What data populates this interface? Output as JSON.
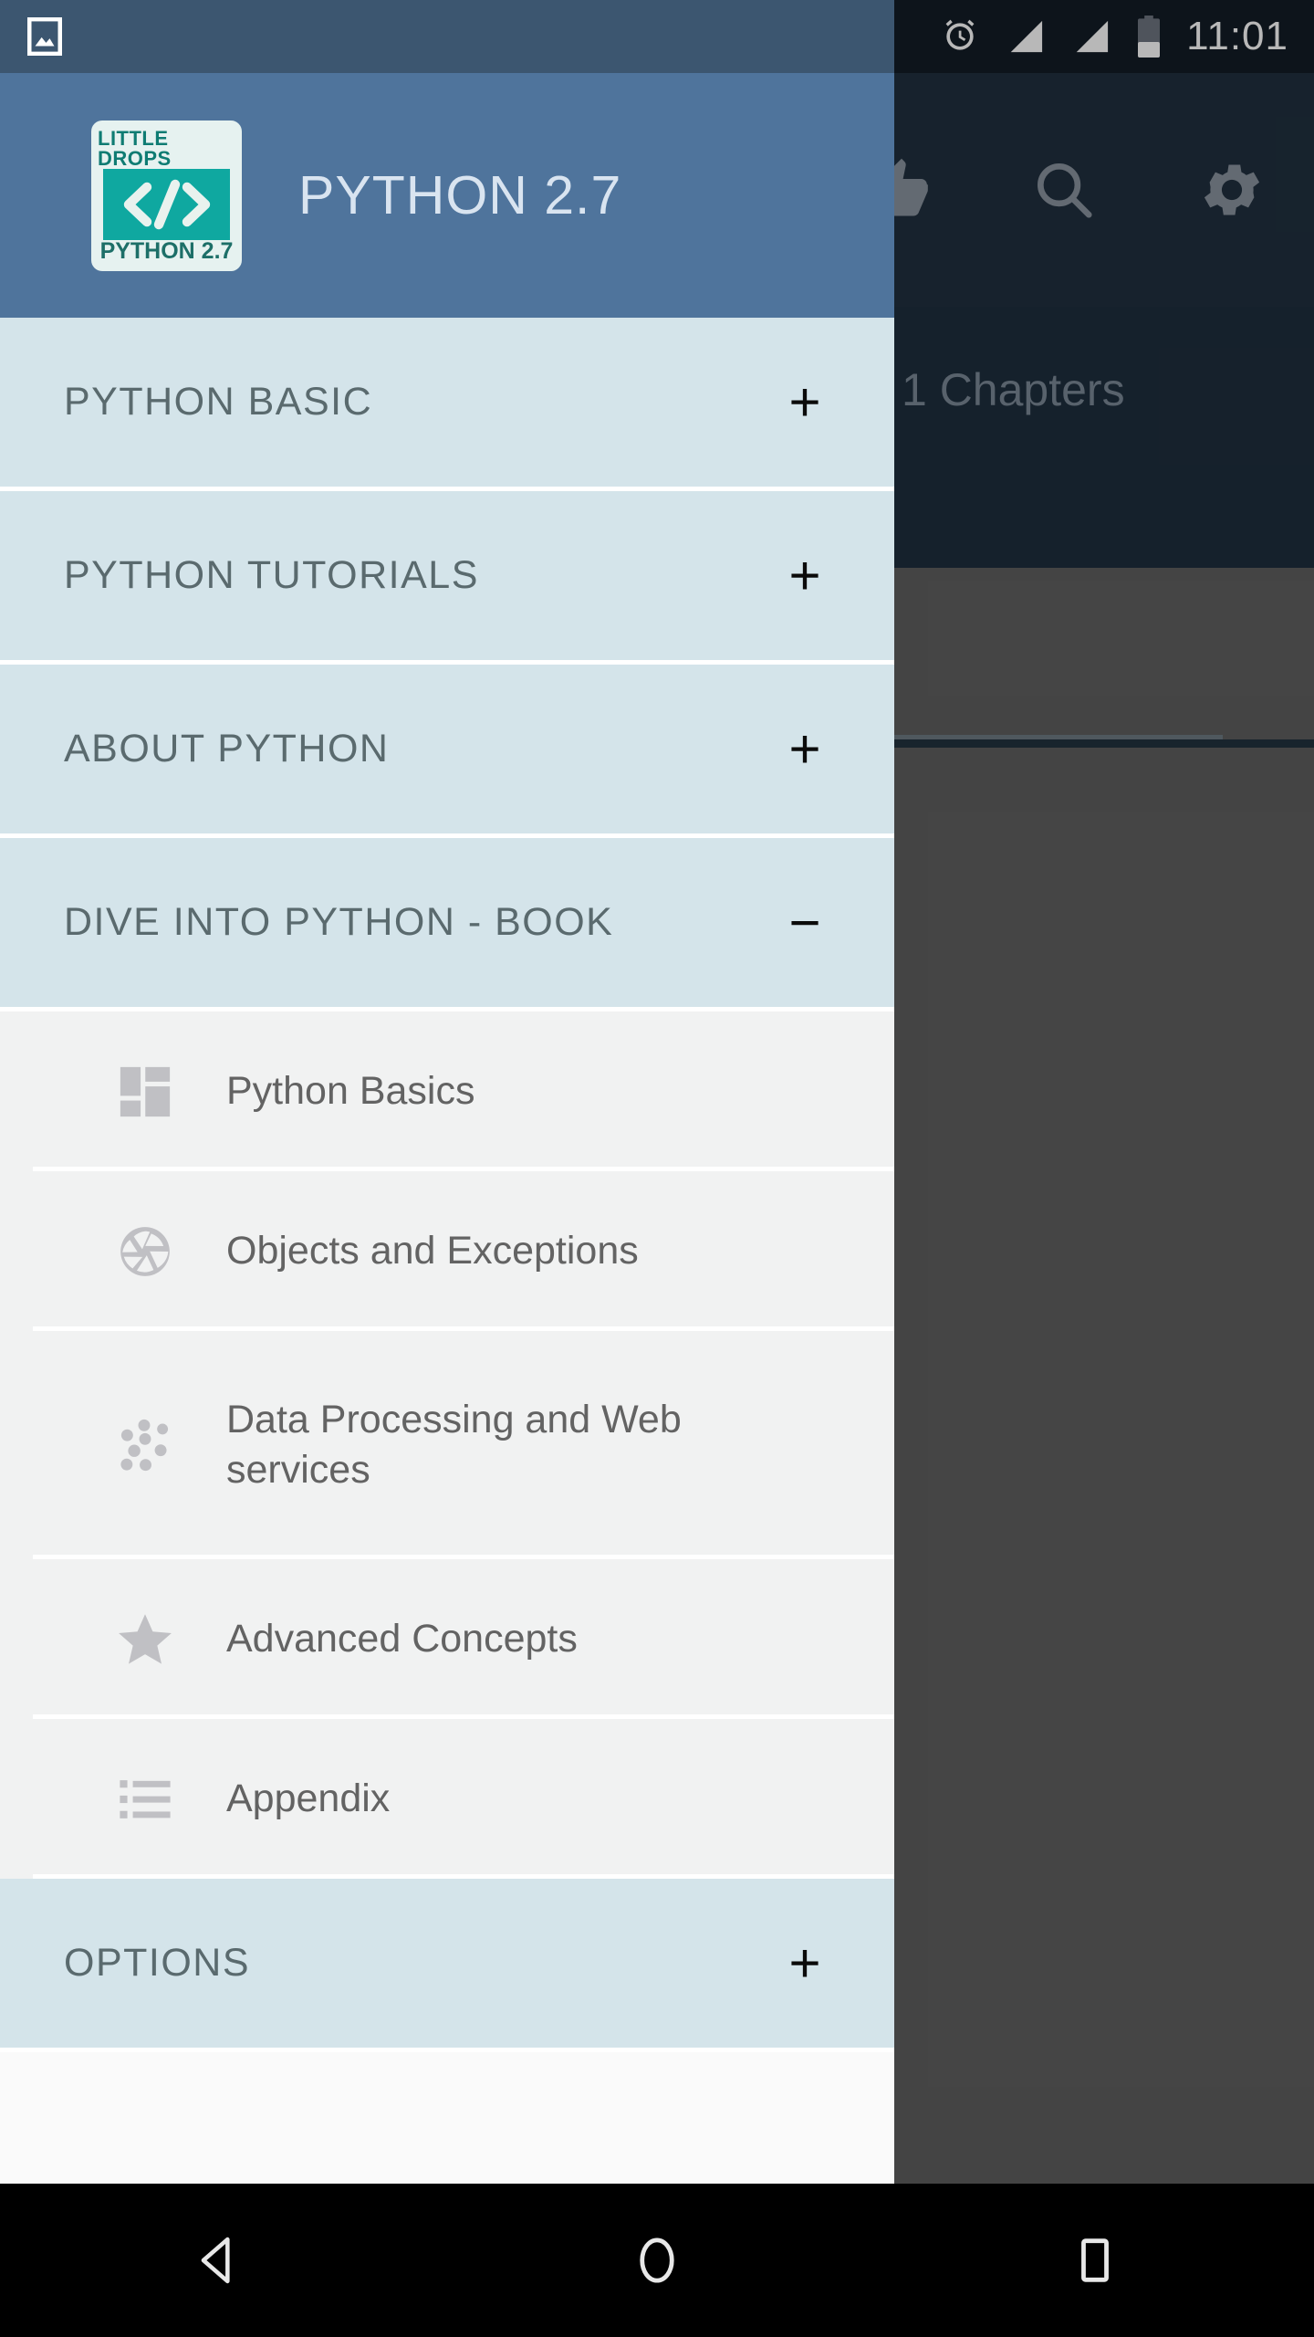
{
  "status_bar": {
    "time": "11:01",
    "icons": [
      "photo-icon",
      "alarm-icon",
      "signal-icon",
      "signal-icon",
      "battery-icon"
    ]
  },
  "background_app": {
    "appbar_icons": [
      "thumbs-up-icon",
      "search-icon",
      "gear-icon"
    ],
    "subheader_text": "1 Chapters"
  },
  "drawer": {
    "header": {
      "title": "PYTHON 2.7",
      "logo": {
        "top_text": "LITTLE DROPS",
        "bottom_text": "PYTHON 2.7",
        "symbol": "</>",
        "accent_color": "#0fa8a0",
        "background_color": "#4f749c"
      }
    },
    "groups": [
      {
        "label": "PYTHON BASIC",
        "toggle": "+",
        "expanded": false
      },
      {
        "label": "PYTHON TUTORIALS",
        "toggle": "+",
        "expanded": false
      },
      {
        "label": "ABOUT PYTHON",
        "toggle": "+",
        "expanded": false
      },
      {
        "label": "DIVE INTO PYTHON - BOOK",
        "toggle": "−",
        "expanded": true
      }
    ],
    "children": [
      {
        "label": "Python Basics",
        "icon": "dashboard-grid-icon"
      },
      {
        "label": "Objects and Exceptions",
        "icon": "aperture-icon"
      },
      {
        "label": "Data Processing and Web services",
        "icon": "bubble-chart-icon"
      },
      {
        "label": "Advanced Concepts",
        "icon": "star-icon"
      },
      {
        "label": "Appendix",
        "icon": "list-icon"
      }
    ],
    "options_group": {
      "label": "OPTIONS",
      "toggle": "+",
      "expanded": false
    },
    "colors": {
      "header": "#4f749c",
      "group_background": "#d4e4ea",
      "child_background": "#f1f2f2",
      "group_text": "#5a6a6e",
      "child_text": "#636363",
      "child_icon": "#c0c0c4"
    }
  },
  "nav_bar": {
    "buttons": [
      "back-button",
      "home-button",
      "recents-button"
    ]
  }
}
